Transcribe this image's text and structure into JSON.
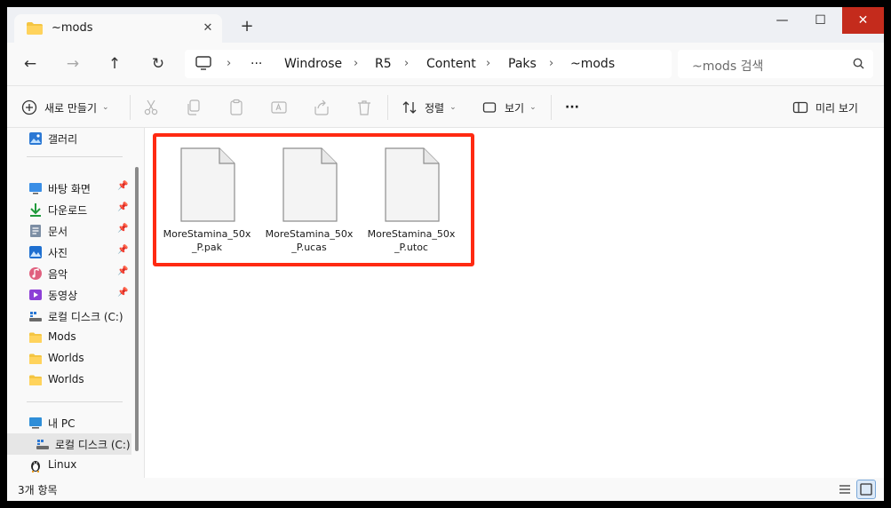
{
  "window": {
    "tab_title": "~mods",
    "tab_close": "✕",
    "new_tab": "+",
    "minimize": "—",
    "maximize": "☐",
    "close": "✕"
  },
  "nav": {
    "back": "←",
    "forward": "→",
    "up": "↑",
    "refresh": "↻",
    "more_crumbs": "···",
    "breadcrumbs": [
      "Windrose",
      "R5",
      "Content",
      "Paks",
      "~mods"
    ],
    "search_placeholder": "~mods 검색"
  },
  "commands": {
    "new": "새로 만들기",
    "sort": "정렬",
    "view": "보기",
    "more": "···",
    "preview": "미리 보기"
  },
  "sidebar": {
    "gallery": "갤러리",
    "quick_access": [
      {
        "label": "바탕 화면",
        "icon": "desktop-icon",
        "pinned": true
      },
      {
        "label": "다운로드",
        "icon": "download-icon",
        "pinned": true
      },
      {
        "label": "문서",
        "icon": "document-icon",
        "pinned": true
      },
      {
        "label": "사진",
        "icon": "pictures-icon",
        "pinned": true
      },
      {
        "label": "음악",
        "icon": "music-icon",
        "pinned": true
      },
      {
        "label": "동영상",
        "icon": "video-icon",
        "pinned": true
      },
      {
        "label": "로컬 디스크 (C:)",
        "icon": "drive-icon",
        "pinned": false
      },
      {
        "label": "Mods",
        "icon": "folder-icon",
        "pinned": false
      },
      {
        "label": "Worlds",
        "icon": "folder-icon",
        "pinned": false
      },
      {
        "label": "Worlds",
        "icon": "folder-icon",
        "pinned": false
      }
    ],
    "this_pc": "내 PC",
    "local_disk": "로컬 디스크 (C:)",
    "linux": "Linux"
  },
  "files": [
    {
      "name": "MoreStamina_50x_P.pak"
    },
    {
      "name": "MoreStamina_50x_P.ucas"
    },
    {
      "name": "MoreStamina_50x_P.utoc"
    }
  ],
  "status": {
    "item_count": "3개 항목"
  },
  "colors": {
    "highlight": "#ff2a12",
    "close_button": "#c42b1c",
    "folder": "#f4c542"
  }
}
